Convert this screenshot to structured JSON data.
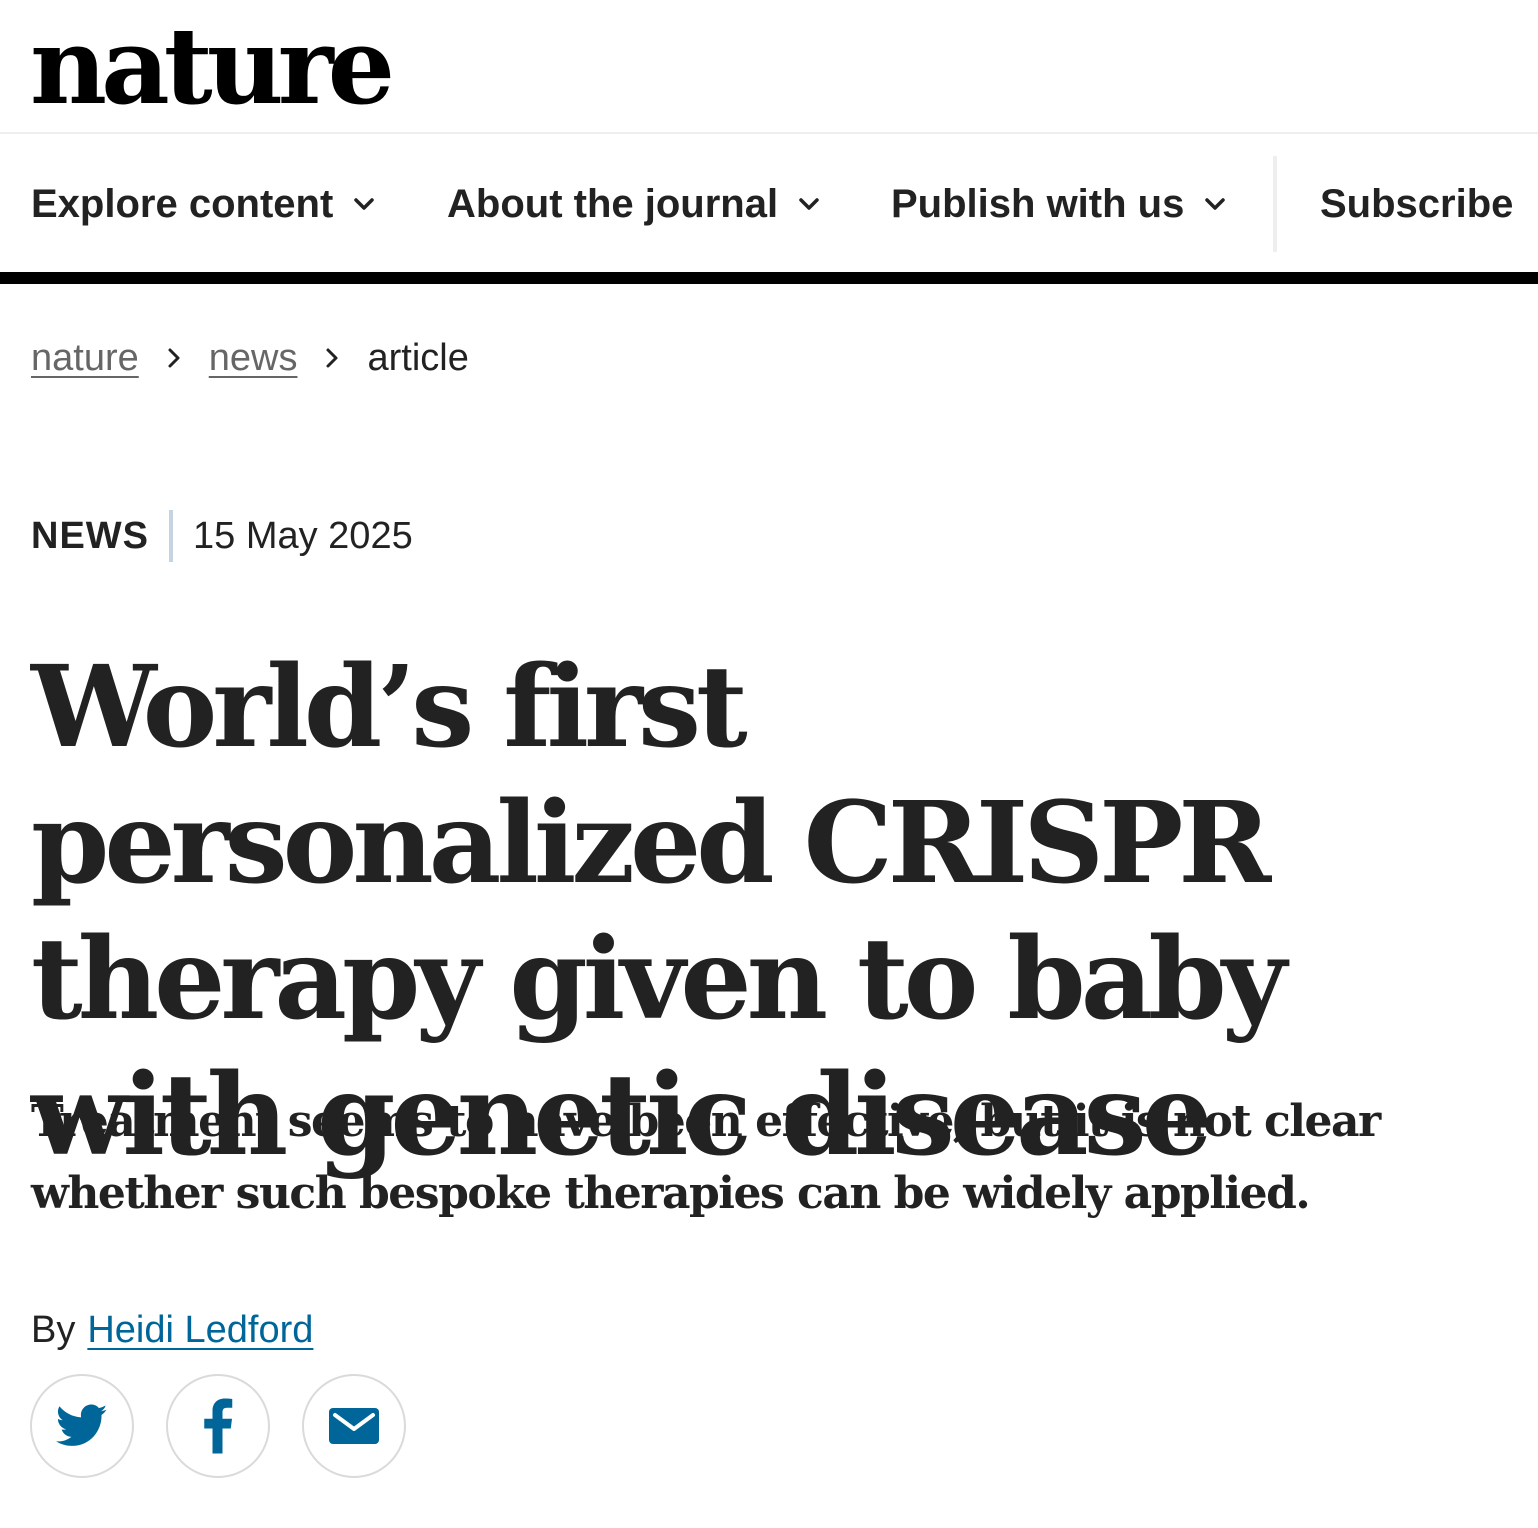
{
  "site": {
    "logo_text": "nature"
  },
  "nav": {
    "items": [
      {
        "label": "Explore content",
        "has_dropdown": true
      },
      {
        "label": "About the journal",
        "has_dropdown": true
      },
      {
        "label": "Publish with us",
        "has_dropdown": true
      },
      {
        "label": "Subscribe",
        "has_dropdown": false
      }
    ]
  },
  "breadcrumb": {
    "items": [
      {
        "label": "nature",
        "is_link": true
      },
      {
        "label": "news",
        "is_link": true
      },
      {
        "label": "article",
        "is_link": false
      }
    ],
    "separator_icon": "chevron-right-icon"
  },
  "article": {
    "type": "NEWS",
    "date": "15 May 2025",
    "title": "World’s first personalized CRISPR therapy given to baby with genetic disease",
    "standfirst": "Treatment seems to have been effective, but it is not clear whether such bespoke therapies can be widely applied.",
    "byline_prefix": "By",
    "author": "Heidi Ledford"
  },
  "share": {
    "buttons": [
      {
        "icon": "twitter-icon",
        "color": "#1da1f2"
      },
      {
        "icon": "facebook-icon",
        "color": "#3b5998"
      },
      {
        "icon": "email-icon",
        "color": "#006699"
      }
    ]
  },
  "colors": {
    "text": "#222222",
    "link_muted": "#666666",
    "author_link": "#006699",
    "nav_rule": "#000000",
    "meta_divider": "#c6d3e0"
  }
}
